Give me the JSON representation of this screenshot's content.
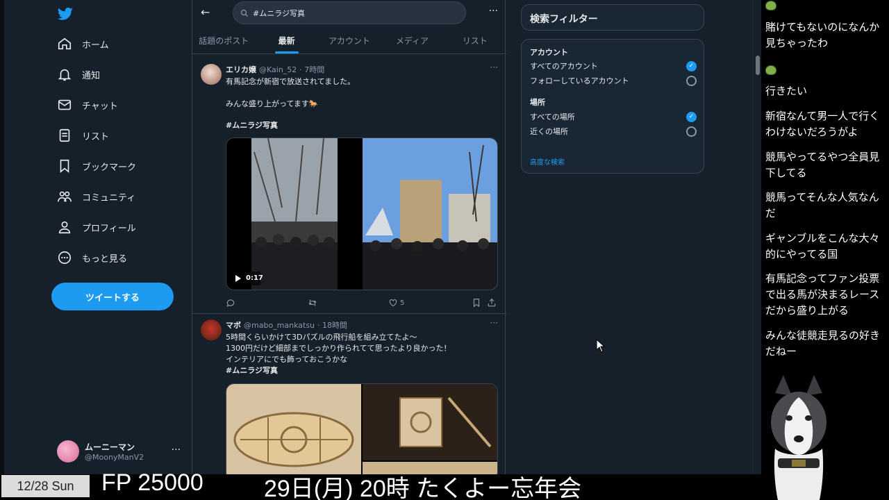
{
  "sidebar": {
    "items": [
      {
        "label": "ホーム",
        "icon": "home-icon"
      },
      {
        "label": "通知",
        "icon": "bell-icon"
      },
      {
        "label": "チャット",
        "icon": "mail-icon"
      },
      {
        "label": "リスト",
        "icon": "list-icon"
      },
      {
        "label": "ブックマーク",
        "icon": "bookmark-icon"
      },
      {
        "label": "コミュニティ",
        "icon": "community-icon"
      },
      {
        "label": "プロフィール",
        "icon": "profile-icon"
      },
      {
        "label": "もっと見る",
        "icon": "more-circle-icon"
      }
    ],
    "tweet_button": "ツイートする",
    "account": {
      "name": "ムーニーマン",
      "handle": "@MoonyManV2"
    }
  },
  "search": {
    "query": "#ムニラジ写真"
  },
  "tabs": [
    "話題のポスト",
    "最新",
    "アカウント",
    "メディア",
    "リスト"
  ],
  "active_tab": "最新",
  "tweets": [
    {
      "name": "エリカ嬢",
      "handle": "@Kain_52",
      "time": "· 7時間",
      "text": "有馬記念が新宿で放送されてました。\n\nみんな盛り上がってます🐎",
      "hashtag": "#ムニラジ写真",
      "video_duration": "0:17",
      "likes": "5"
    },
    {
      "name": "マボ",
      "handle": "@mabo_mankatsu",
      "time": "· 18時間",
      "text": "5時間くらいかけて3Dパズルの飛行船を組み立てたよ〜\n1300円だけど細部までしっかり作られてて思ったより良かった！\nインテリアにでも飾っておこうかな",
      "hashtag": "#ムニラジ写真"
    }
  ],
  "filters": {
    "title": "検索フィルター",
    "account_section": "アカウント",
    "account_options": [
      {
        "label": "すべてのアカウント",
        "selected": true
      },
      {
        "label": "フォローしているアカウント",
        "selected": false
      }
    ],
    "place_section": "場所",
    "place_options": [
      {
        "label": "すべての場所",
        "selected": true
      },
      {
        "label": "近くの場所",
        "selected": false
      }
    ],
    "advanced": "高度な検索"
  },
  "chat": {
    "messages": [
      "賭けてもないのになんか見ちゃったわ",
      "行きたい",
      "新宿なんて男一人で行くわけないだろうがよ",
      "競馬やってるやつ全員見下してる",
      "競馬ってそんな人気なんだ",
      "ギャンブルをこんな大々的にやってる国",
      "有馬記念ってファン投票で出る馬が決まるレースだから盛り上がる",
      "みんな徒競走見るの好きだねー"
    ]
  },
  "overlay": {
    "date": "12/28 Sun",
    "fp": "FP 25000",
    "schedule": "29日(月) 20時 たくよー忘年会"
  },
  "colors": {
    "accent": "#1d9bf0",
    "background": "#15202b",
    "border": "#38444d"
  }
}
